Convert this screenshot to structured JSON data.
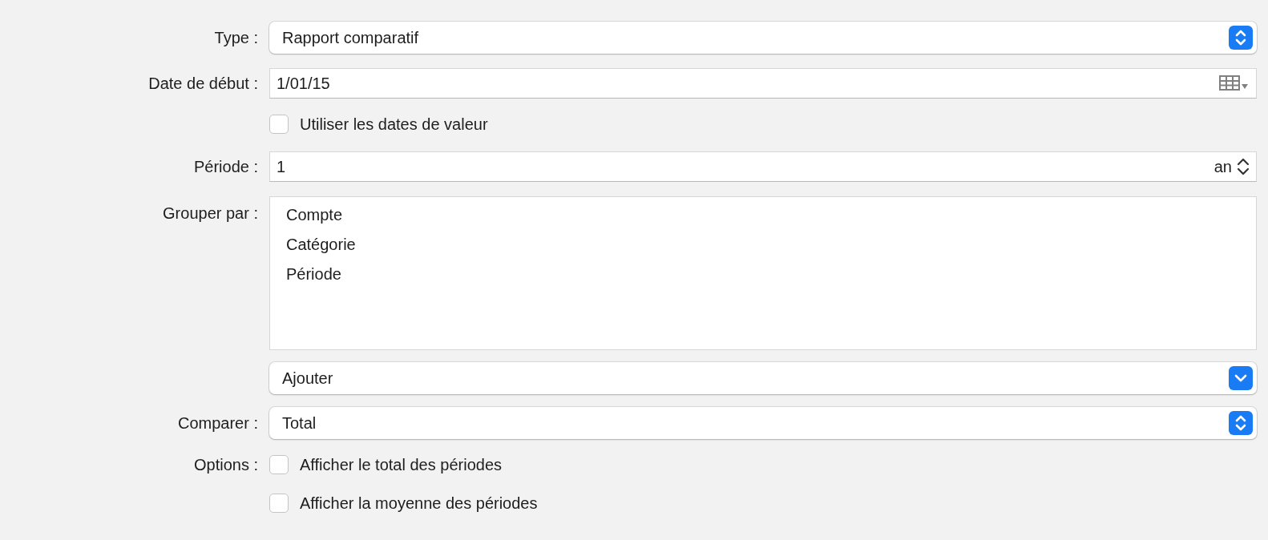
{
  "rows": [
    {
      "kind": "popup",
      "label": "Type :",
      "value": "Rapport comparatif"
    },
    {
      "kind": "date",
      "label": "Date de début :",
      "value": "1/01/15"
    },
    {
      "kind": "checkbox",
      "text": "Utiliser les dates de valeur",
      "checked": false
    },
    {
      "kind": "stepper",
      "label": "Période :",
      "value": "1",
      "unit": "an"
    },
    {
      "kind": "list",
      "label": "Grouper par :",
      "items": [
        "Compte",
        "Catégorie",
        "Période"
      ]
    },
    {
      "kind": "pulldown",
      "value": "Ajouter"
    },
    {
      "kind": "popup",
      "label": "Comparer :",
      "value": "Total"
    },
    {
      "kind": "checkbox",
      "label": "Options :",
      "text": "Afficher le total des périodes",
      "checked": false
    },
    {
      "kind": "checkbox",
      "text": "Afficher la moyenne des périodes",
      "checked": false
    }
  ]
}
